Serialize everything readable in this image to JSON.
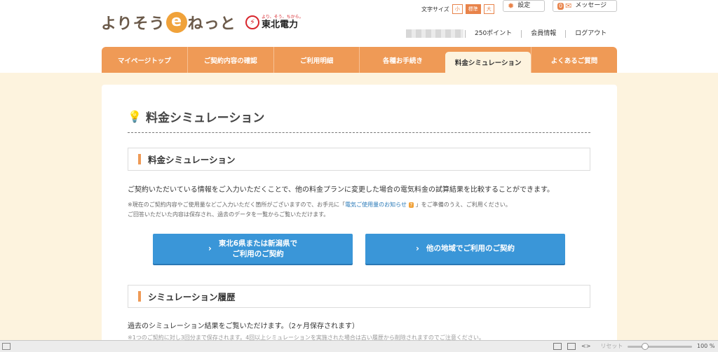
{
  "header": {
    "logo_pre": "よりそう",
    "logo_e": "e",
    "logo_post": "ねっと",
    "partner_tagline": "より、そう、ちから。",
    "partner_name": "東北電力",
    "fontsize_label": "文字サイズ",
    "fontsize_options": [
      "小",
      "標準",
      "大"
    ],
    "settings_label": "設定",
    "message_count": "0",
    "message_label": "メッセージ",
    "points": "250ポイント",
    "member_info": "会員情報",
    "logout": "ログアウト"
  },
  "nav": {
    "items": [
      "マイページトップ",
      "ご契約内容の確認",
      "ご利用明細",
      "各種お手続き",
      "料金シミュレーション",
      "よくあるご質問"
    ],
    "active": "料金シミュレーション"
  },
  "main": {
    "page_title": "料金シミュレーション",
    "section1_title": "料金シミュレーション",
    "description": "ご契約いただいている情報をご入力いただくことで、他の料金プランに変更した場合の電気料金の試算結果を比較することができます。",
    "note_line1_pre": "※現在のご契約内容やご使用量などご入力いただく箇所がございますので、お手元に「",
    "note_link": "電気ご使用量のお知らせ",
    "note_q": "?",
    "note_line1_post": "」をご準備のうえ、ご利用ください。",
    "note_line2": "ご回答いただいた内容は保存され、過去のデータを一覧からご覧いただけます。",
    "button1_line1": "東北6県または新潟県で",
    "button1_line2": "ご利用のご契約",
    "button2_label": "他の地域でご利用のご契約",
    "section2_title": "シミュレーション履歴",
    "history_desc": "過去のシミュレーション結果をご覧いただけます。（2ヶ月保存されます）",
    "history_cut": "※1つのご契約に対し3回分まで保存されます。4回以上シミュレーションを実施された場合は古い履歴から削除されますのでご注意ください。"
  },
  "statusbar": {
    "reset_label": "リセット",
    "zoom": "100 %"
  },
  "colors": {
    "accent": "#ef9a56",
    "button_blue": "#3a96d8",
    "page_bg": "#fdf3de"
  }
}
